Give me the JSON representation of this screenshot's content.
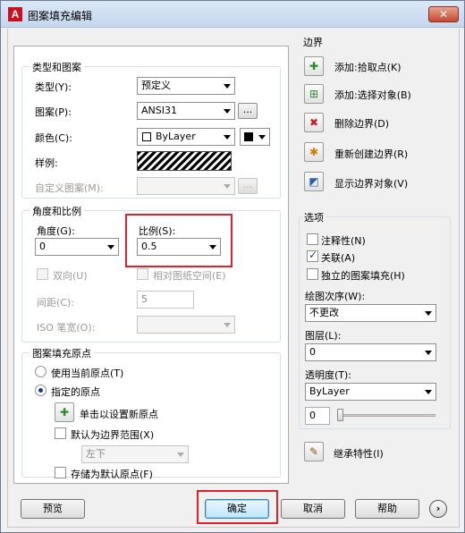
{
  "window": {
    "title": "图案填充编辑",
    "close_glyph": "✕"
  },
  "pattern_group": {
    "title": "类型和图案",
    "type_label": "类型(Y):",
    "type_value": "预定义",
    "pattern_label": "图案(P):",
    "pattern_value": "ANSI31",
    "browse_label": "...",
    "color_label": "颜色(C):",
    "color_value": "ByLayer",
    "color_swatch": "#000000",
    "swatch_label": "样例:",
    "custom_label": "自定义图案(M):",
    "custom_value": "",
    "custom_browse": "..."
  },
  "angle_group": {
    "title": "角度和比例",
    "angle_label": "角度(G):",
    "angle_value": "0",
    "scale_label": "比例(S):",
    "scale_value": "0.5",
    "double_label": "双向(U)",
    "relative_label": "相对图纸空间(E)",
    "spacing_label": "间距(C):",
    "spacing_value": "5",
    "iso_label": "ISO 笔宽(O):",
    "iso_value": ""
  },
  "origin_group": {
    "title": "图案填充原点",
    "use_current_label": "使用当前原点(T)",
    "specified_label": "指定的原点",
    "click_set_label": "单击以设置新原点",
    "default_extent_label": "默认为边界范围(X)",
    "extent_value": "左下",
    "store_default_label": "存储为默认原点(F)"
  },
  "boundary_group": {
    "title": "边界",
    "add_pick_label": "添加:拾取点(K)",
    "add_select_label": "添加:选择对象(B)",
    "remove_label": "删除边界(D)",
    "recreate_label": "重新创建边界(R)",
    "view_label": "显示边界对象(V)"
  },
  "options_group": {
    "title": "选项",
    "annotative_label": "注释性(N)",
    "associative_label": "关联(A)",
    "separate_label": "独立的图案填充(H)",
    "draw_order_label": "绘图次序(W):",
    "draw_order_value": "不更改",
    "layer_label": "图层(L):",
    "layer_value": "0",
    "transparency_label": "透明度(T):",
    "transparency_value": "ByLayer",
    "transparency_number": "0",
    "transparency_level": 0
  },
  "inherit_label": "继承特性(I)",
  "buttons": {
    "preview": "预览",
    "ok": "确定",
    "cancel": "取消",
    "help": "帮助",
    "more": "›"
  }
}
